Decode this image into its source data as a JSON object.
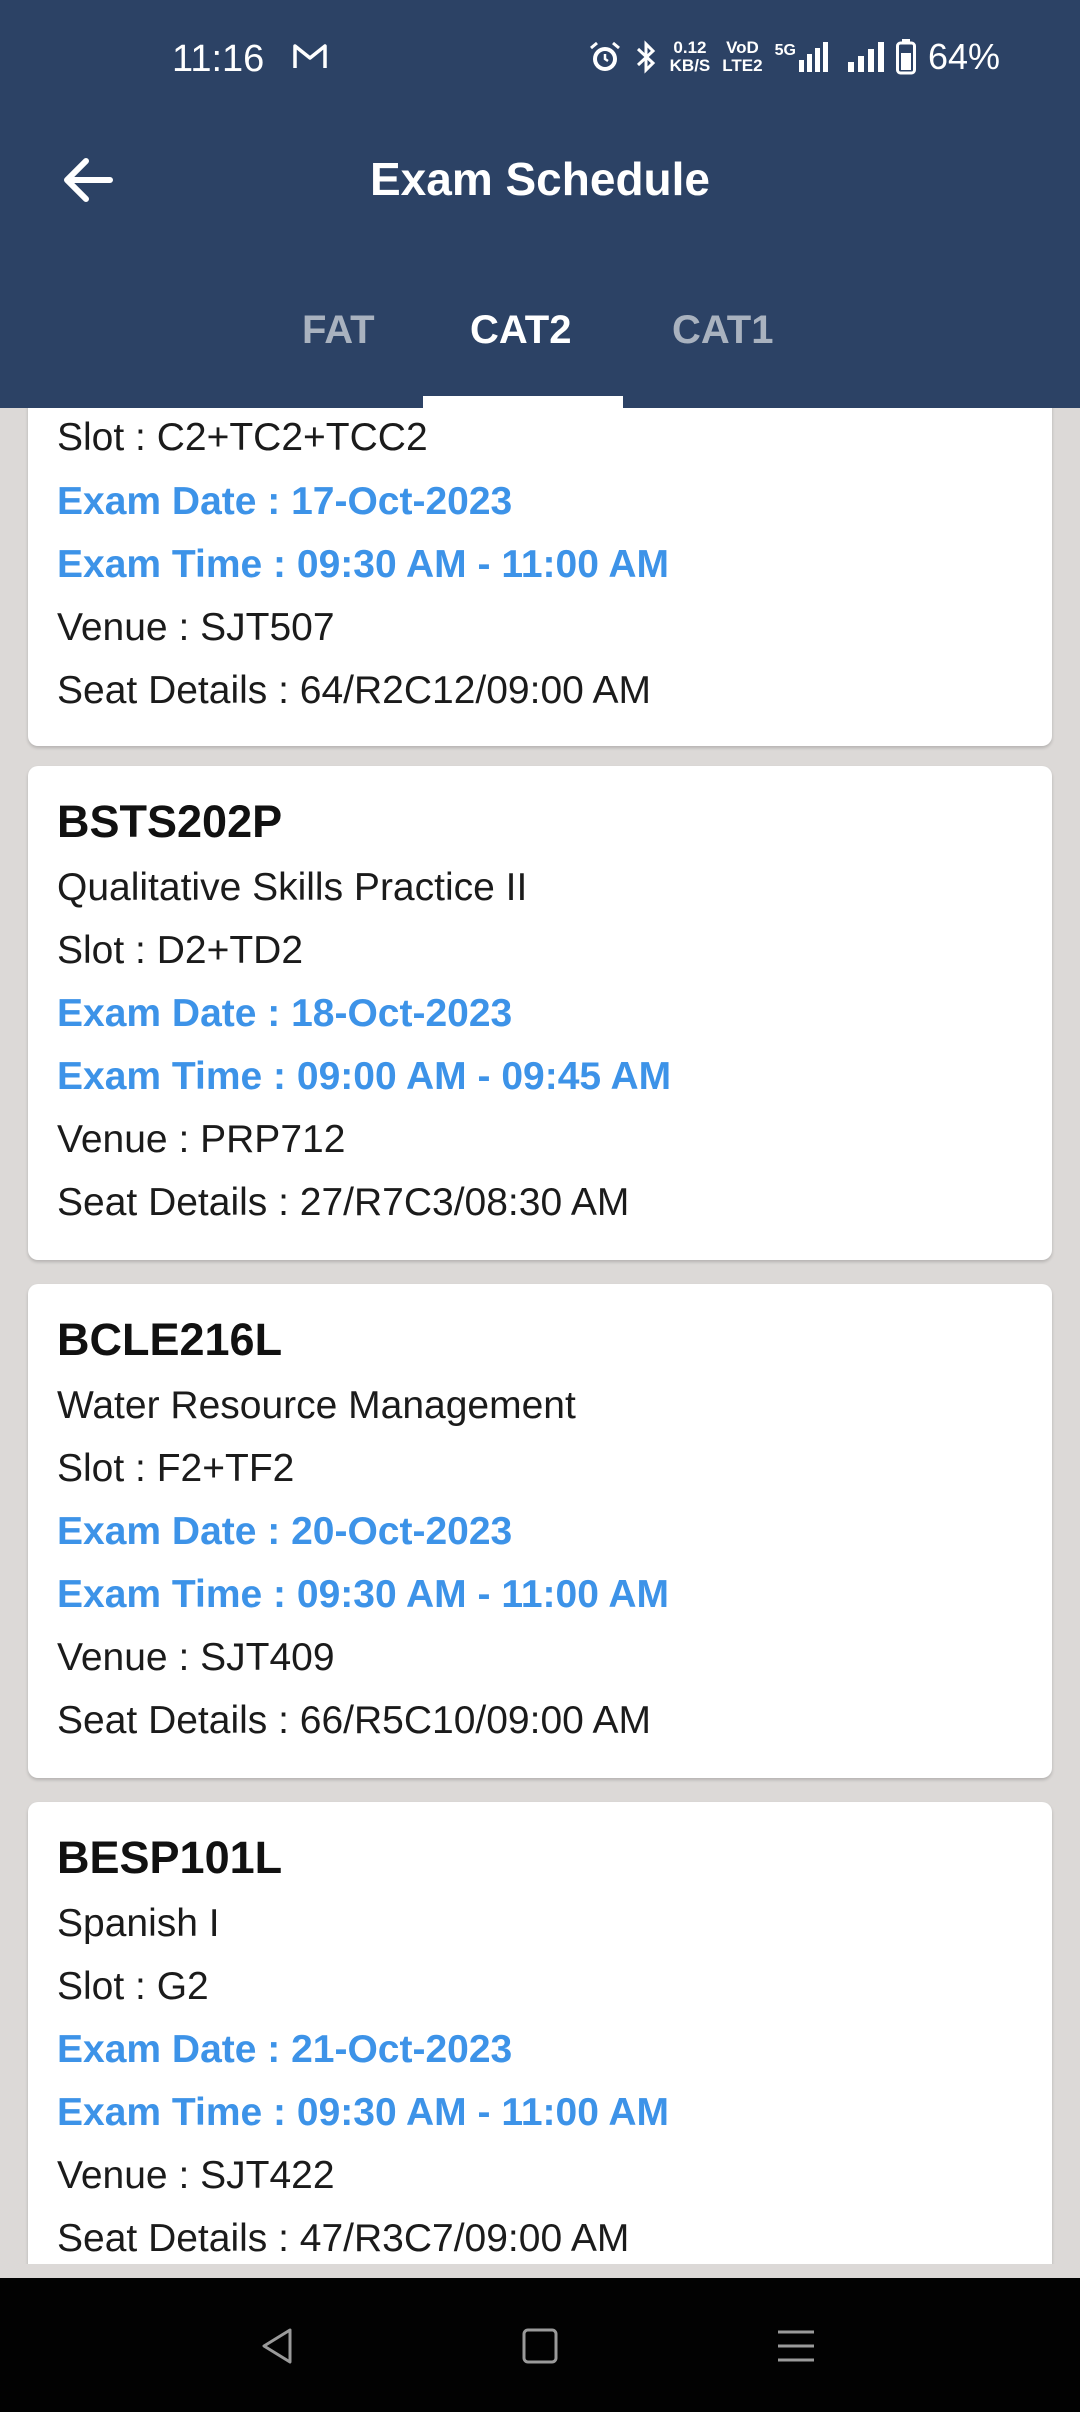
{
  "status": {
    "time": "11:16",
    "net_speed_value": "0.12",
    "net_speed_unit": "KB/S",
    "volte_top": "VoD",
    "volte_bottom": "LTE2",
    "network": "5G",
    "battery": "64%"
  },
  "appbar": {
    "title": "Exam Schedule"
  },
  "tabs": [
    {
      "label": "FAT",
      "active": false
    },
    {
      "label": "CAT2",
      "active": true
    },
    {
      "label": "CAT1",
      "active": false
    }
  ],
  "cards": [
    {
      "slot": "Slot : C2+TC2+TCC2",
      "exam_date": "Exam Date : 17-Oct-2023",
      "exam_time": "Exam Time : 09:30 AM - 11:00 AM",
      "venue": "Venue : SJT507",
      "seat": "Seat Details : 64/R2C12/09:00 AM"
    },
    {
      "code": "BSTS202P",
      "name": "Qualitative Skills Practice II",
      "slot": "Slot : D2+TD2",
      "exam_date": "Exam Date : 18-Oct-2023",
      "exam_time": "Exam Time : 09:00 AM - 09:45 AM",
      "venue": "Venue : PRP712",
      "seat": "Seat Details : 27/R7C3/08:30 AM"
    },
    {
      "code": "BCLE216L",
      "name": "Water Resource Management",
      "slot": "Slot : F2+TF2",
      "exam_date": "Exam Date : 20-Oct-2023",
      "exam_time": "Exam Time : 09:30 AM - 11:00 AM",
      "venue": "Venue : SJT409",
      "seat": "Seat Details : 66/R5C10/09:00 AM"
    },
    {
      "code": "BESP101L",
      "name": "Spanish I",
      "slot": "Slot : G2",
      "exam_date": "Exam Date : 21-Oct-2023",
      "exam_time": "Exam Time : 09:30 AM - 11:00 AM",
      "venue": "Venue : SJT422",
      "seat": "Seat Details : 47/R3C7/09:00 AM"
    }
  ],
  "navbar": {
    "back_icon": "triangle-back-icon",
    "home_icon": "square-home-icon",
    "menu_icon": "lines-menu-icon"
  },
  "colors": {
    "header_bg": "#2c4265",
    "accent_blue": "#3d93e8",
    "page_bg": "#dcd9d7"
  }
}
